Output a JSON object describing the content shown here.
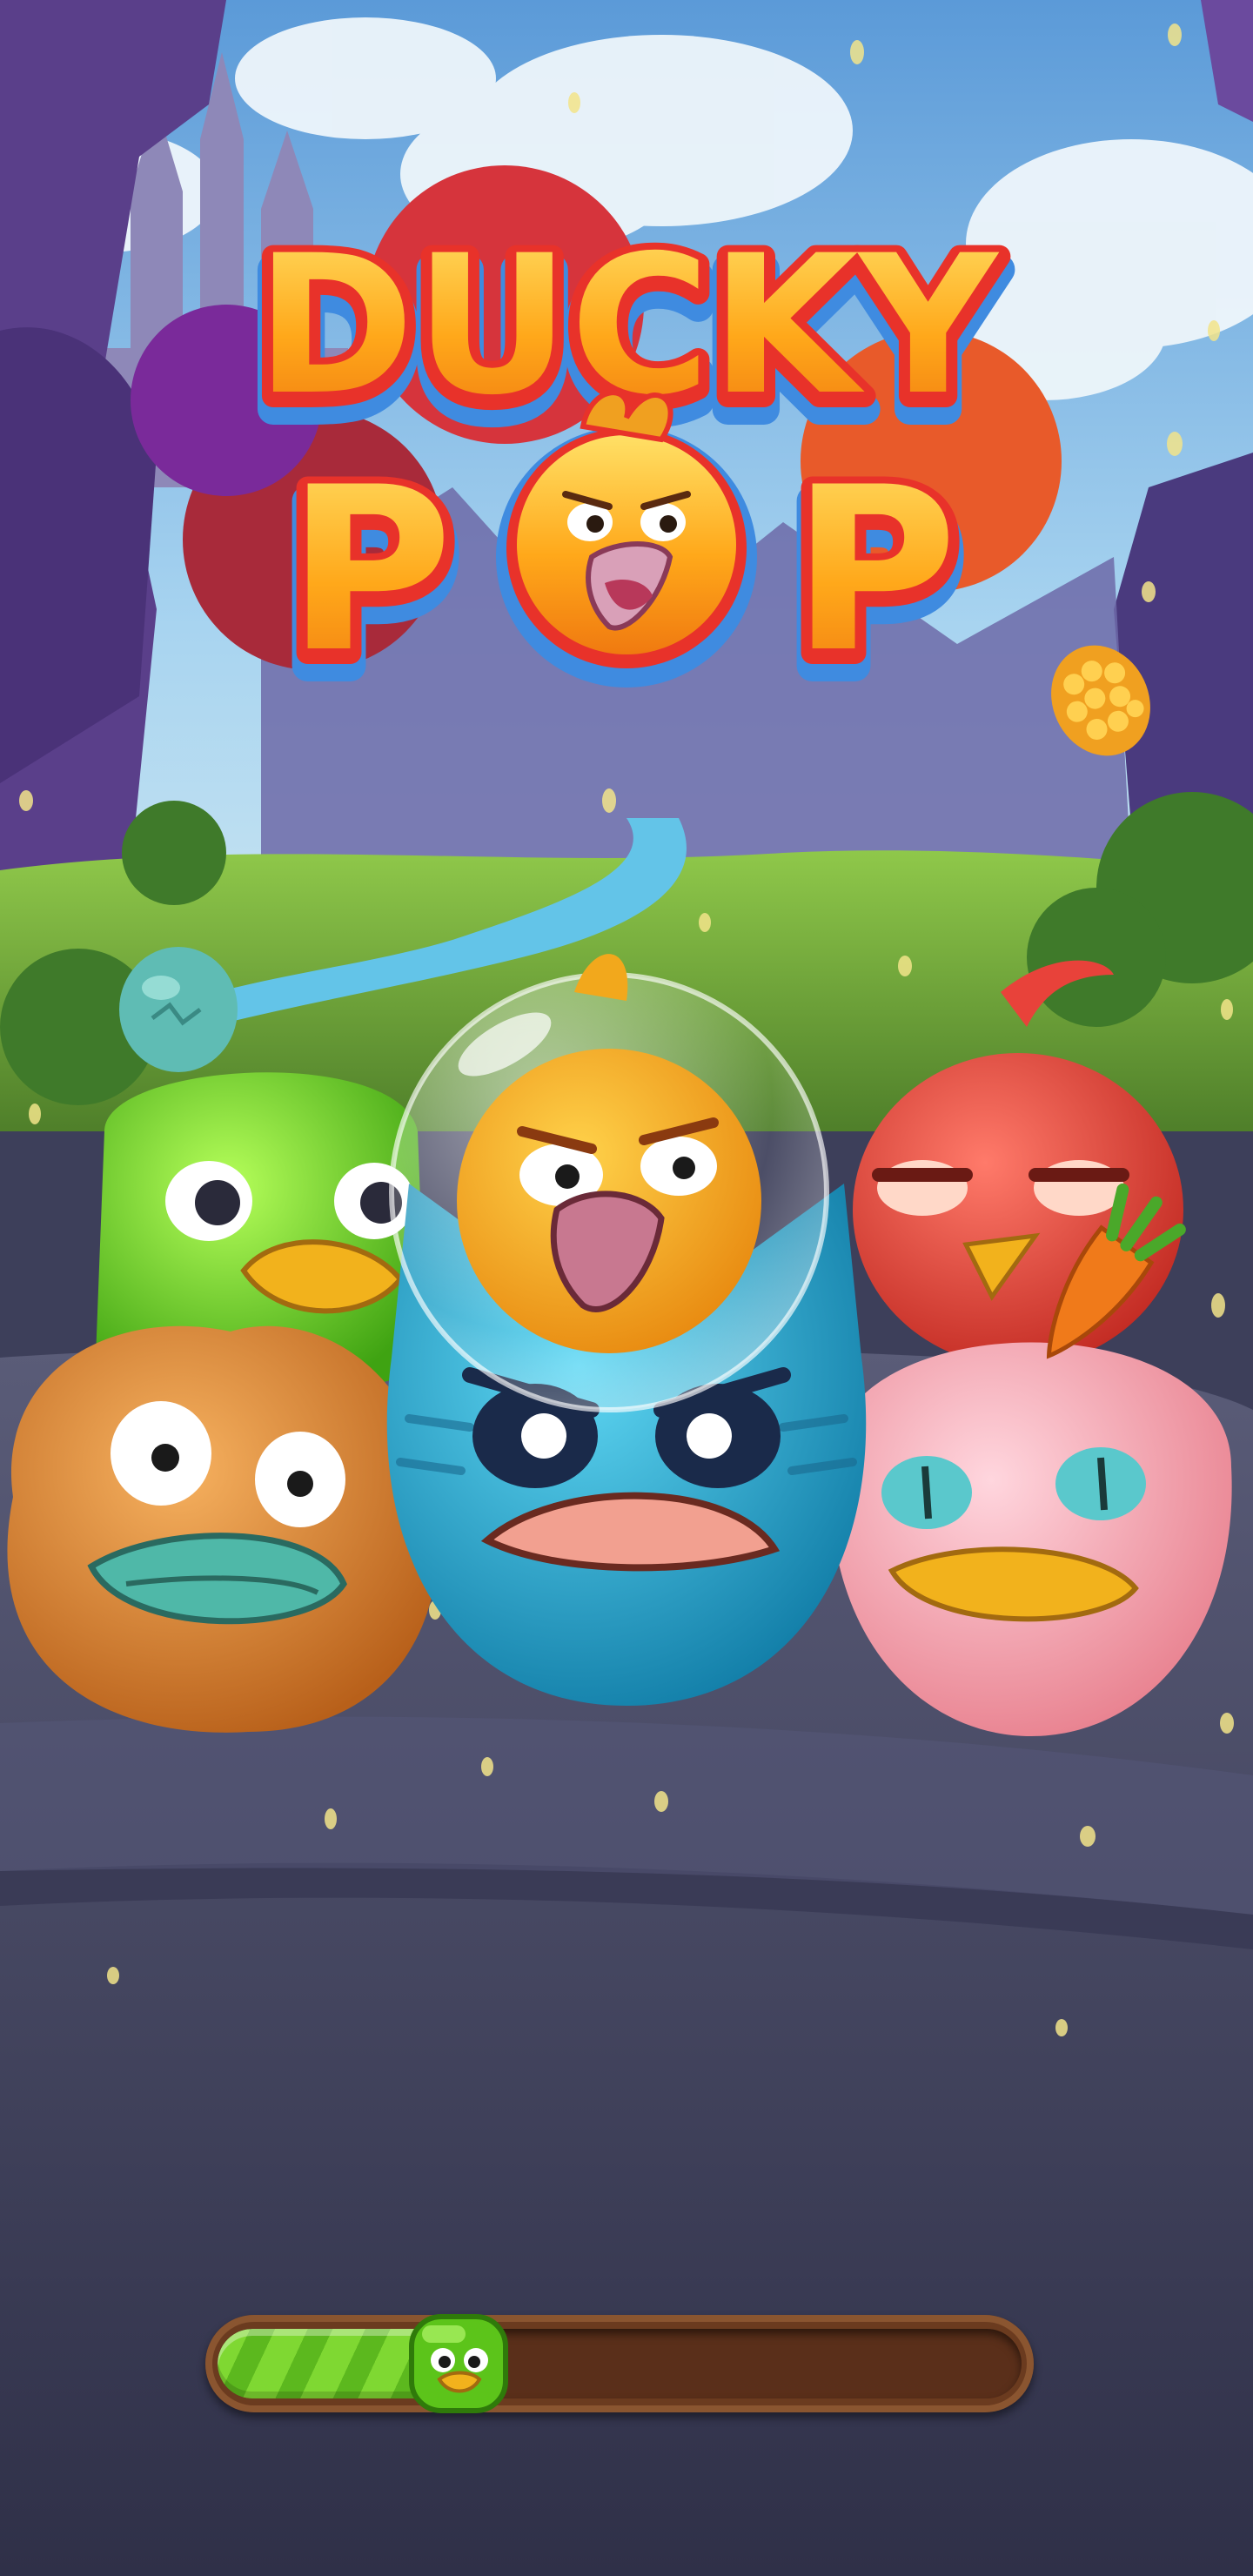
{
  "title": {
    "line1": "DUCKY",
    "line2_left": "P",
    "line2_right": "P"
  },
  "loading": {
    "progress": 0.3,
    "knob": "green-duck-icon"
  },
  "characters": [
    {
      "name": "green-duck-character",
      "color": "#66cc22"
    },
    {
      "name": "orange-fluffy-duck-character",
      "color": "#e0822a"
    },
    {
      "name": "blue-cat-duck-character",
      "color": "#22a8cc"
    },
    {
      "name": "yellow-bubble-duck-character",
      "color": "#f2a81c"
    },
    {
      "name": "red-bird-character",
      "color": "#e8423a"
    },
    {
      "name": "pink-duck-character",
      "color": "#f4a0b0"
    }
  ],
  "colors": {
    "title_fill": "#ffb21c",
    "title_outline": "#e8322a",
    "title_shadow": "#3f8be0",
    "sky": "#7ab6e8",
    "ground": "#4b4d6a"
  }
}
